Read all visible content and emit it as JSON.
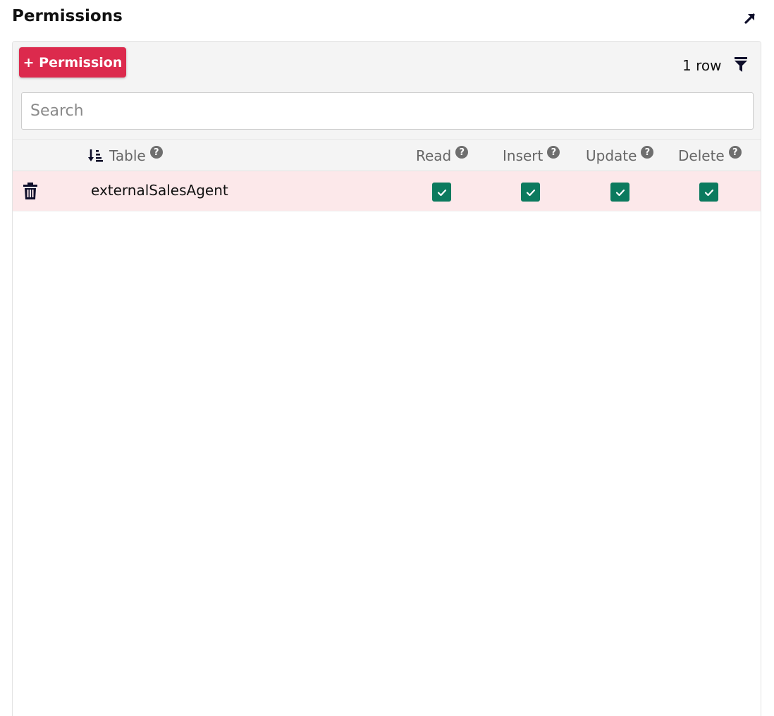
{
  "header": {
    "title": "Permissions",
    "expand_icon": "arrow-up-right-icon"
  },
  "toolbar": {
    "add_label": "+ Permission",
    "row_count": "1 row",
    "filter_icon": "filter-icon"
  },
  "search": {
    "placeholder": "Search",
    "value": ""
  },
  "table": {
    "columns": [
      {
        "key": "table",
        "label": "Table",
        "sortable": true,
        "help_icon": "question-circle-icon"
      },
      {
        "key": "read",
        "label": "Read",
        "help_icon": "question-circle-icon"
      },
      {
        "key": "insert",
        "label": "Insert",
        "help_icon": "question-circle-icon"
      },
      {
        "key": "update",
        "label": "Update",
        "help_icon": "question-circle-icon"
      },
      {
        "key": "delete",
        "label": "Delete",
        "help_icon": "question-circle-icon"
      }
    ],
    "rows": [
      {
        "table": "externalSalesAgent",
        "read": true,
        "insert": true,
        "update": true,
        "delete": true,
        "delete_icon": "trash-icon"
      }
    ]
  },
  "colors": {
    "accent": "#dc2a4d",
    "checkbox": "#0b7a5e",
    "row_highlight": "#fce8ea",
    "toolbar_bg": "#f4f4f4"
  }
}
